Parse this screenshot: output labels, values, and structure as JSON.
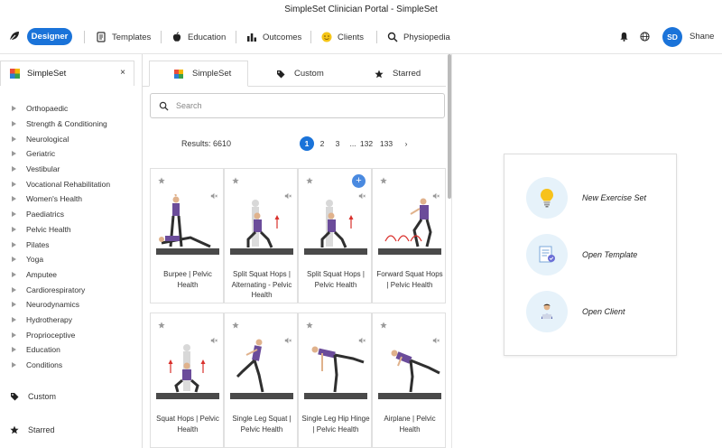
{
  "window": {
    "title": "SimpleSet Clinician Portal - SimpleSet"
  },
  "nav": {
    "designer_label": "Designer",
    "items": [
      {
        "label": "Templates",
        "icon": "document-icon"
      },
      {
        "label": "Education",
        "icon": "apple-icon"
      },
      {
        "label": "Outcomes",
        "icon": "bar-chart-icon"
      },
      {
        "label": "Clients",
        "icon": "smiley-icon"
      },
      {
        "label": "Physiopedia",
        "icon": "search-icon"
      }
    ],
    "avatar_initials": "SD",
    "username": "Shane"
  },
  "sidebar": {
    "header": "SimpleSet",
    "close": "×",
    "categories": [
      "Orthopaedic",
      "Strength & Conditioning",
      "Neurological",
      "Geriatric",
      "Vestibular",
      "Vocational Rehabilitation",
      "Women's Health",
      "Paediatrics",
      "Pelvic Health",
      "Pilates",
      "Yoga",
      "Amputee",
      "Cardiorespiratory",
      "Neurodynamics",
      "Hydrotherapy",
      "Proprioceptive",
      "Education",
      "Conditions"
    ],
    "custom_label": "Custom",
    "starred_label": "Starred"
  },
  "tabs": [
    {
      "label": "SimpleSet",
      "active": true
    },
    {
      "label": "Custom",
      "active": false
    },
    {
      "label": "Starred",
      "active": false
    }
  ],
  "search": {
    "placeholder": "Search",
    "value": ""
  },
  "results": {
    "label": "Results: 6610"
  },
  "pagination": {
    "pages": [
      "1",
      "2",
      "3",
      "...",
      "132",
      "133",
      "›"
    ],
    "current": "1"
  },
  "exercises": [
    {
      "name": "Burpee | Pelvic Health",
      "add_visible": false
    },
    {
      "name": "Split Squat Hops | Alternating - Pelvic Health",
      "add_visible": false
    },
    {
      "name": "Split Squat Hops | Pelvic Health",
      "add_visible": true
    },
    {
      "name": "Forward Squat Hops | Pelvic Health",
      "add_visible": false
    },
    {
      "name": "Squat Hops | Pelvic Health",
      "add_visible": false
    },
    {
      "name": "Single Leg Squat | Pelvic Health",
      "add_visible": false
    },
    {
      "name": "Single Leg Hip Hinge | Pelvic Health",
      "add_visible": false
    },
    {
      "name": "Airplane | Pelvic Health",
      "add_visible": false
    }
  ],
  "add_symbol": "+",
  "actions": [
    {
      "label": "New Exercise Set",
      "icon": "lightbulb-icon"
    },
    {
      "label": "Open Template",
      "icon": "template-document-icon"
    },
    {
      "label": "Open Client",
      "icon": "client-person-icon"
    }
  ],
  "colors": {
    "accent": "#1a73d9",
    "figure_shirt": "#6b4c9a",
    "floor": "#4a4a4a",
    "arrow": "#d9302c"
  }
}
